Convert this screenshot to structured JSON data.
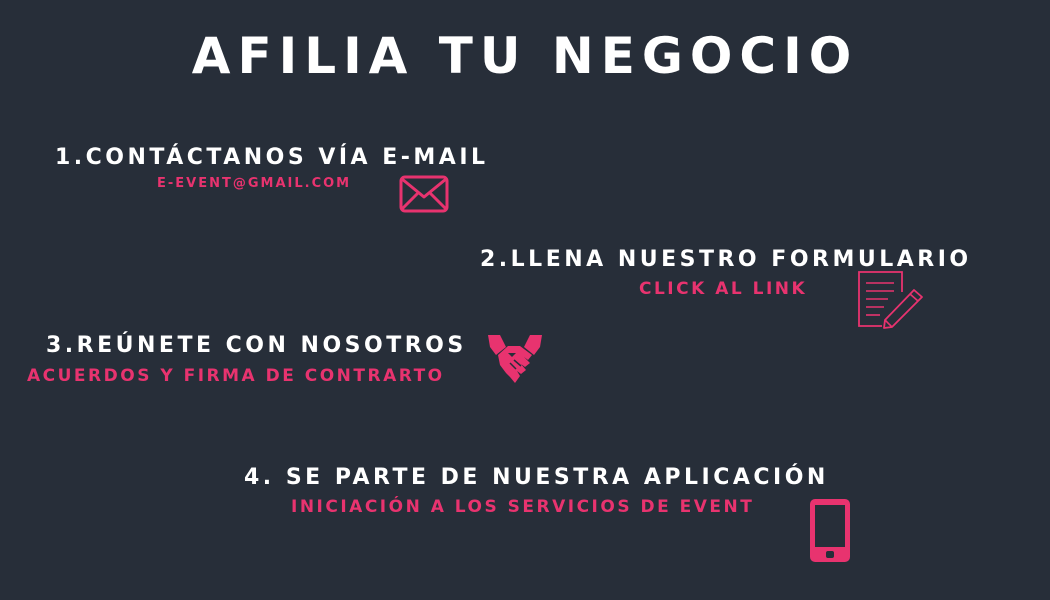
{
  "title": "AFILIA TU NEGOCIO",
  "colors": {
    "background": "#272e39",
    "accent": "#e8336f",
    "text": "#ffffff"
  },
  "steps": [
    {
      "title": "1.CONTÁCTANOS VÍA E-MAIL",
      "subtitle": "E-EVENT@GMAIL.COM",
      "icon": "envelope-icon"
    },
    {
      "title": "2.LLENA NUESTRO FORMULARIO",
      "subtitle": "CLICK AL LINK",
      "icon": "form-pencil-icon"
    },
    {
      "title": "3.REÚNETE CON NOSOTROS",
      "subtitle": "ACUERDOS Y FIRMA DE CONTRARTO",
      "icon": "handshake-icon"
    },
    {
      "title": "4. SE PARTE DE NUESTRA APLICACIÓN",
      "subtitle": "INICIACIÓN A LOS SERVICIOS DE EVENT",
      "icon": "smartphone-icon"
    }
  ]
}
